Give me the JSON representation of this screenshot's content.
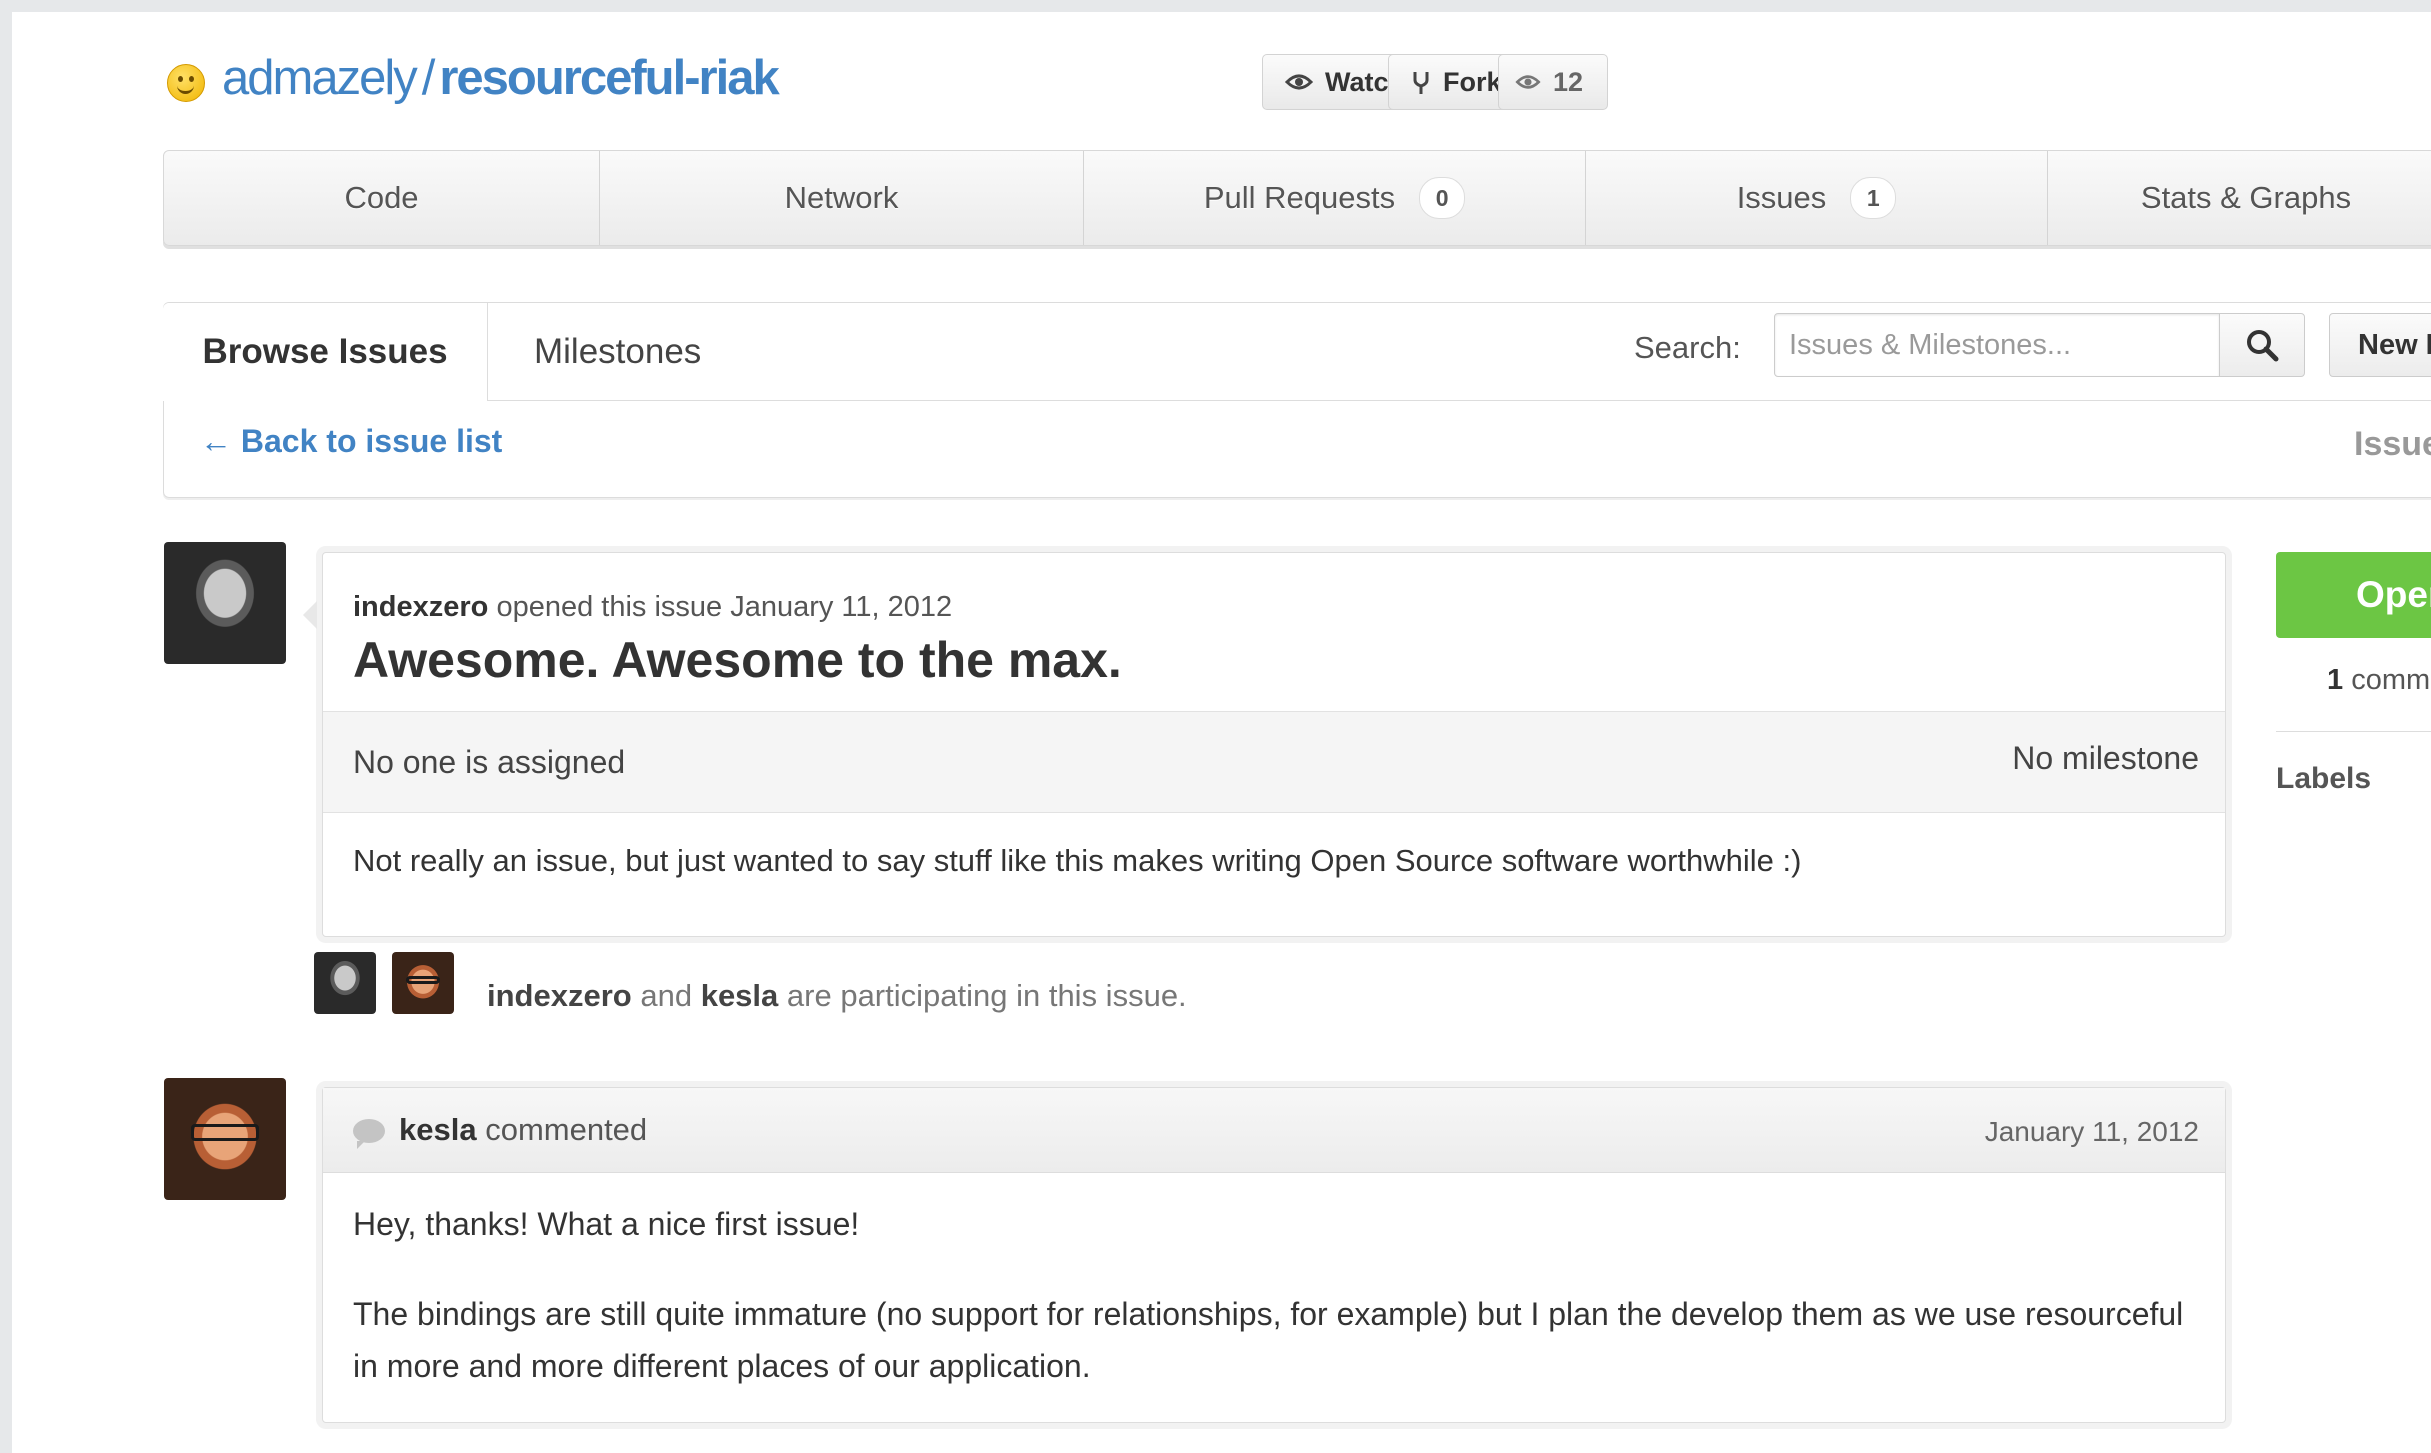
{
  "repo": {
    "owner": "admazely",
    "separator": "/",
    "name": "resourceful-riak"
  },
  "header_buttons": {
    "watch_label": "Watch",
    "fork_label": "Fork",
    "watchers_count": "12"
  },
  "tabnav": {
    "items": [
      {
        "label": "Code"
      },
      {
        "label": "Network"
      },
      {
        "label": "Pull Requests",
        "count": "0"
      },
      {
        "label": "Issues",
        "count": "1"
      },
      {
        "label": "Stats & Graphs"
      }
    ]
  },
  "browse": {
    "tab_browse": "Browse Issues",
    "tab_milestones": "Milestones",
    "search_label": "Search:",
    "search_placeholder": "Issues & Milestones...",
    "new_issue_label": "New Is",
    "back_link": "← Back to issue list",
    "issue_number_label": "Issue"
  },
  "issue": {
    "author": "indexzero",
    "opened_text": "opened this issue January 11, 2012",
    "title": "Awesome. Awesome to the max.",
    "assignee": "No one is assigned",
    "milestone": "No milestone",
    "body": "Not really an issue, but just wanted to say stuff like this makes writing Open Source software worthwhile :)"
  },
  "participants": {
    "user1": "indexzero",
    "and_text": "and",
    "user2": "kesla",
    "suffix": "are participating in this issue."
  },
  "comment": {
    "author": "kesla",
    "action": "commented",
    "date": "January 11, 2012",
    "p1": "Hey, thanks! What a nice first issue!",
    "p2": "The bindings are still quite immature (no support for relationships, for example) but I plan the develop them as we use resourceful in more and more different places of our application."
  },
  "sidebar": {
    "state_label": "Open",
    "comment_count": "1",
    "comment_count_suffix": "comm",
    "labels_heading": "Labels"
  },
  "colors": {
    "link": "#4183c4",
    "open_green": "#6cc644"
  }
}
